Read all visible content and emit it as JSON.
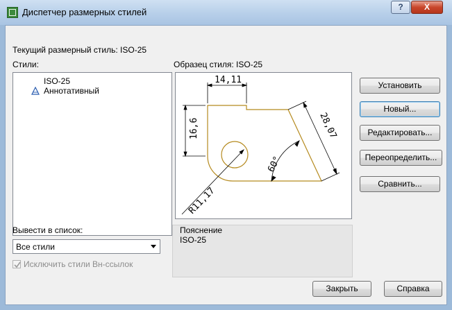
{
  "window": {
    "title": "Диспетчер размерных стилей",
    "help_glyph": "?",
    "close_glyph": "X"
  },
  "current_style": "Текущий размерный стиль: ISO-25",
  "styles": {
    "label": "Стили:",
    "items": [
      "ISO-25",
      "Аннотативный"
    ]
  },
  "preview": {
    "label": "Образец стиля: ISO-25",
    "dimensions": {
      "top": "14,11",
      "left": "16,6",
      "right": "28,07",
      "angle": "60°",
      "radius": "R11,17"
    },
    "accent_color": "#b58a1e"
  },
  "buttons": {
    "set": "Установить",
    "new": "Новый...",
    "edit": "Редактировать...",
    "override": "Переопределить...",
    "compare": "Сравнить...",
    "close": "Закрыть",
    "help": "Справка"
  },
  "filter": {
    "label": "Вывести в список:",
    "value": "Все стили"
  },
  "exclude_xrefs": {
    "label": "Исключить стили Вн-ссылок",
    "checked": true
  },
  "description": {
    "label": "Пояснение",
    "text": "ISO-25"
  }
}
